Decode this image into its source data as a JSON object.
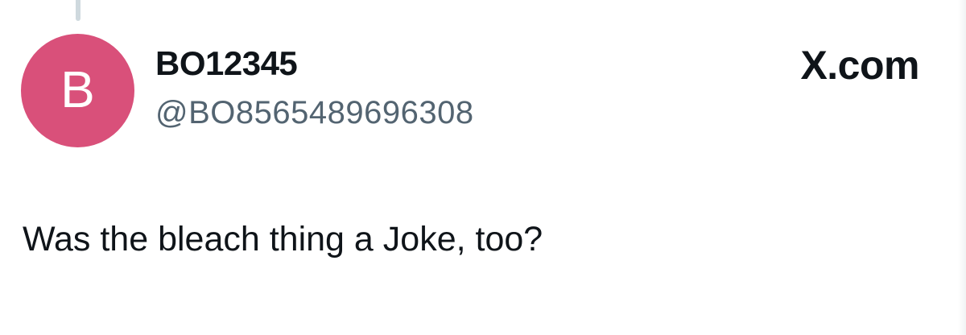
{
  "post": {
    "avatar_initial": "B",
    "display_name": "BO12345",
    "handle": "@BO8565489696308",
    "text": "Was the bleach thing a Joke, too?"
  },
  "brand": {
    "domain": "X.com"
  },
  "colors": {
    "avatar_background": "#d9507a",
    "handle_text": "#536471",
    "primary_text": "#0f1419",
    "thread_line": "#cfd9de"
  },
  "icons": {
    "brand_logo": "x-logo-icon"
  }
}
